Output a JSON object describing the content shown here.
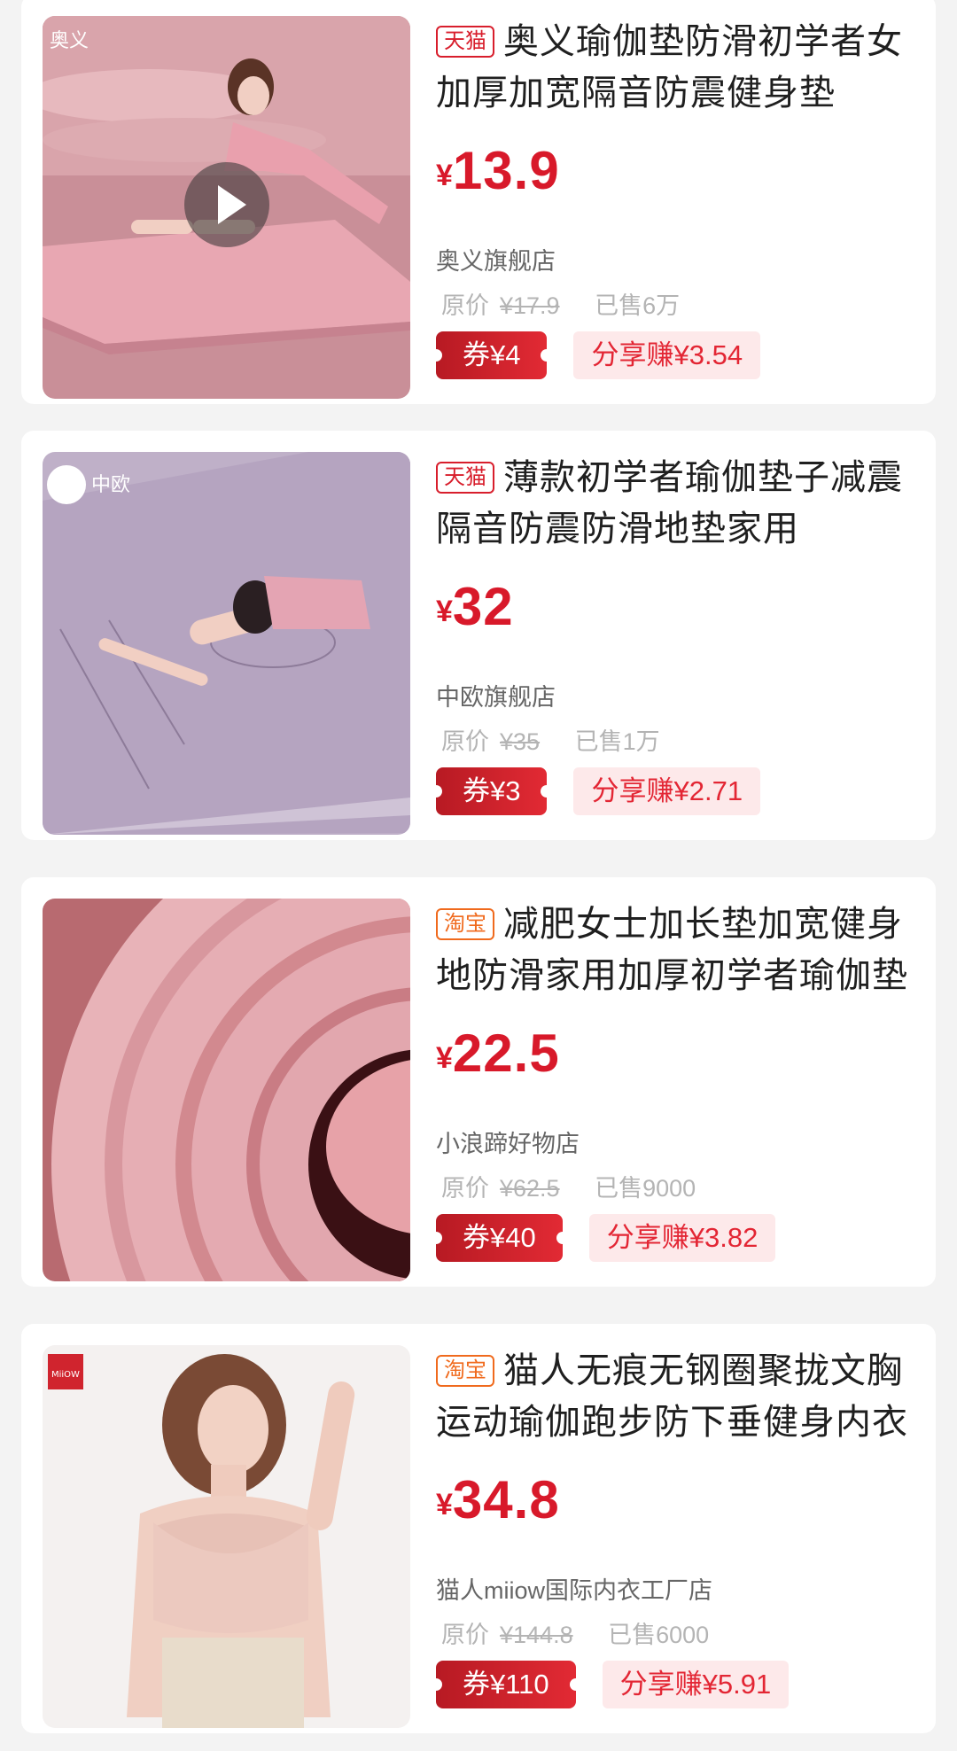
{
  "products": [
    {
      "platform": "天猫",
      "platform_type": "tmall",
      "title": "奥义瑜伽垫防滑初学者女加厚加宽隔音防震健身垫",
      "price_symbol": "¥",
      "price": "13.9",
      "shop": "奥义旗舰店",
      "original_label": "原价",
      "original_price": "¥17.9",
      "sold": "已售6万",
      "coupon": "券¥4",
      "share": "分享赚¥3.54",
      "brand_logo": "奥义",
      "has_video": true
    },
    {
      "platform": "天猫",
      "platform_type": "tmall",
      "title": "薄款初学者瑜伽垫子减震隔音防震防滑地垫家用",
      "price_symbol": "¥",
      "price": "32",
      "shop": "中欧旗舰店",
      "original_label": "原价",
      "original_price": "¥35",
      "sold": "已售1万",
      "coupon": "券¥3",
      "share": "分享赚¥2.71",
      "brand_logo": "中欧",
      "has_video": false
    },
    {
      "platform": "淘宝",
      "platform_type": "taobao",
      "title": "减肥女士加长垫加宽健身地防滑家用加厚初学者瑜伽垫",
      "price_symbol": "¥",
      "price": "22.5",
      "shop": "小浪蹄好物店",
      "original_label": "原价",
      "original_price": "¥62.5",
      "sold": "已售9000",
      "coupon": "券¥40",
      "share": "分享赚¥3.82",
      "brand_logo": "",
      "has_video": false
    },
    {
      "platform": "淘宝",
      "platform_type": "taobao",
      "title": "猫人无痕无钢圈聚拢文胸运动瑜伽跑步防下垂健身内衣",
      "price_symbol": "¥",
      "price": "34.8",
      "shop": "猫人miiow国际内衣工厂店",
      "original_label": "原价",
      "original_price": "¥144.8",
      "sold": "已售6000",
      "coupon": "券¥110",
      "share": "分享赚¥5.91",
      "brand_logo": "MiiOW",
      "has_video": false
    }
  ]
}
